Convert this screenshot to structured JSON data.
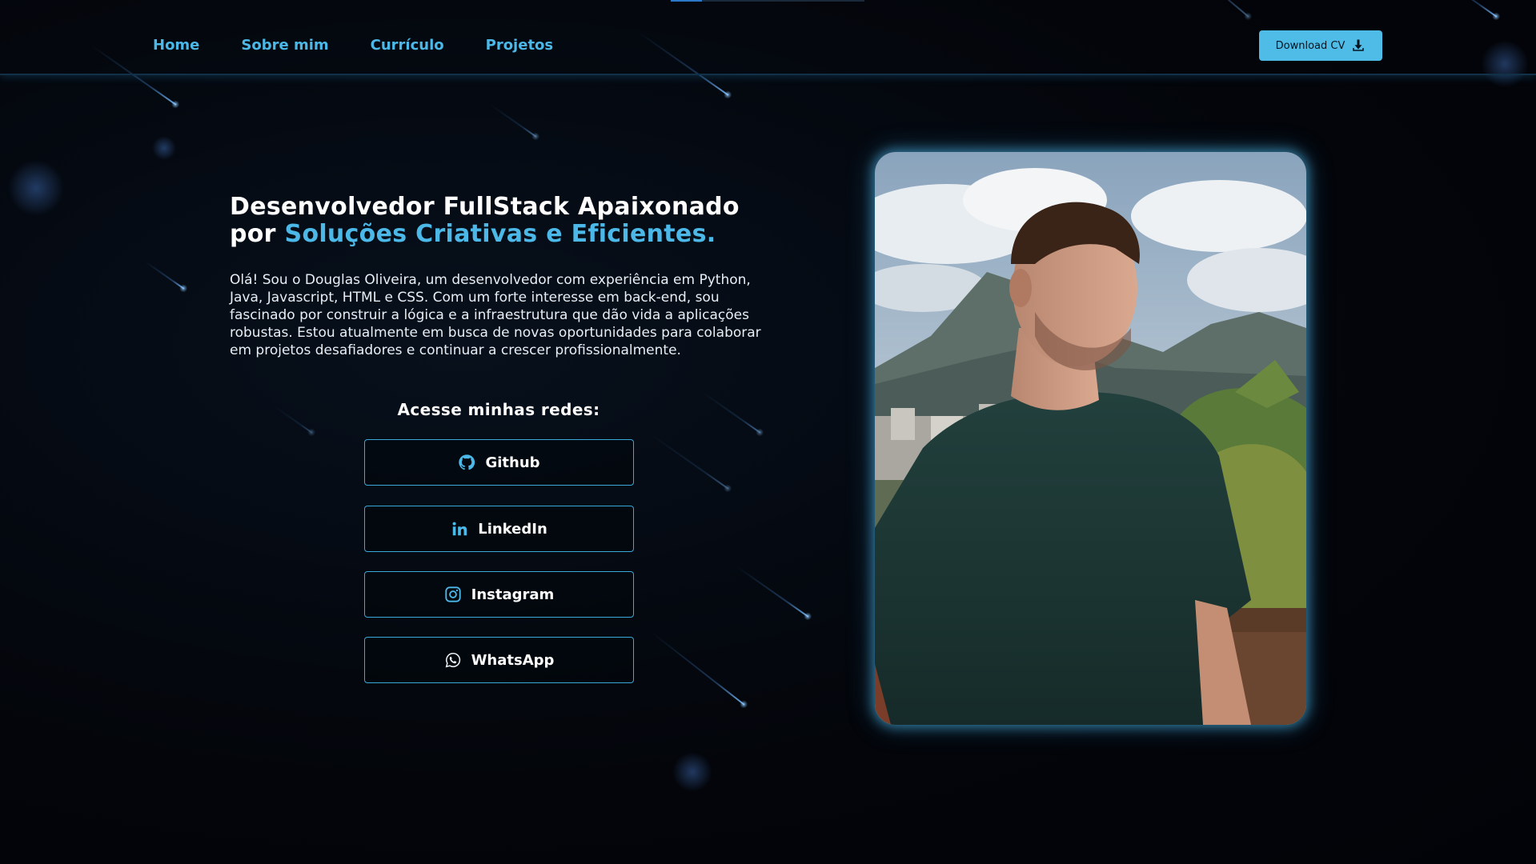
{
  "nav": {
    "links": [
      "Home",
      "Sobre mim",
      "Currículo",
      "Projetos"
    ],
    "download_label": "Download CV",
    "download_icon": "download-icon"
  },
  "scroll_progress": 0.16,
  "hero": {
    "headline_plain": "Desenvolvedor FullStack Apaixonado por ",
    "headline_accent": "Soluções Criativas e Eficientes.",
    "intro": "Olá! Sou o Douglas Oliveira, um desenvolvedor com experiência em Python, Java, Javascript, HTML e CSS. Com um forte interesse em back-end, sou fascinado por construir a lógica e a infraestrutura que dão vida a aplicações robustas. Estou atualmente em busca de novas oportunidades para colaborar em projetos desafiadores e continuar a crescer profissionalmente.",
    "networks_title": "Acesse minhas redes:",
    "networks": [
      {
        "label": "Github",
        "icon": "github-icon"
      },
      {
        "label": "LinkedIn",
        "icon": "linkedin-icon"
      },
      {
        "label": "Instagram",
        "icon": "instagram-icon"
      },
      {
        "label": "WhatsApp",
        "icon": "whatsapp-icon"
      }
    ]
  },
  "colors": {
    "accent": "#4bb8e8",
    "background": "#04060b",
    "button_bg": "#4fbce8"
  }
}
